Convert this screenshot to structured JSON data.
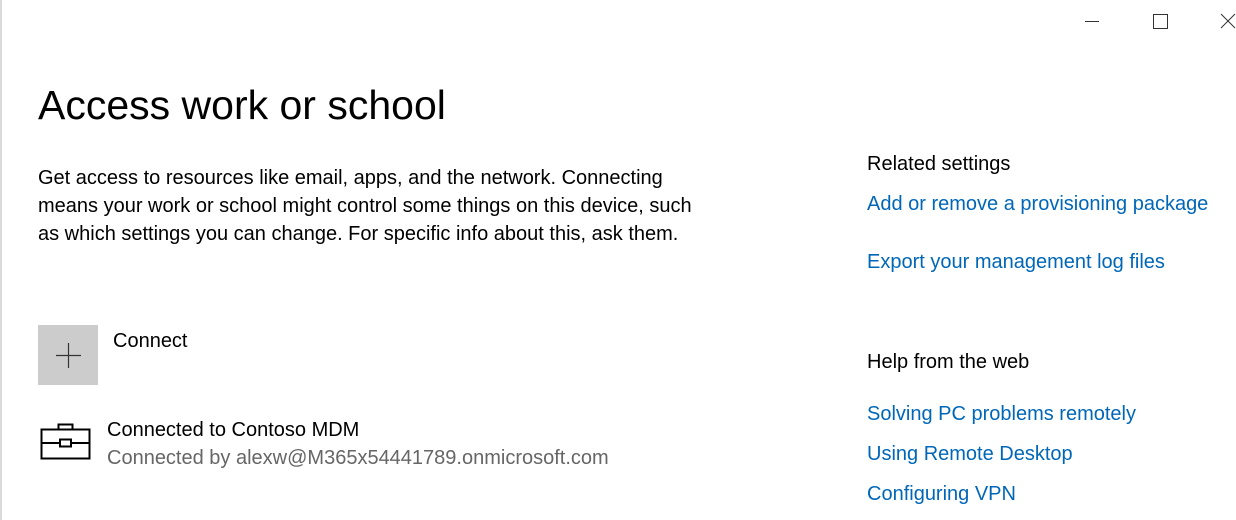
{
  "window": {
    "minimize_icon": "minimize-icon",
    "maximize_icon": "maximize-icon",
    "close_icon": "close-icon"
  },
  "main": {
    "title": "Access work or school",
    "description": "Get access to resources like email, apps, and the network. Connecting means your work or school might control some things on this device, such as which settings you can change. For specific info about this, ask them.",
    "connect": {
      "icon": "plus-icon",
      "label": "Connect"
    },
    "account": {
      "icon": "briefcase-icon",
      "title": "Connected to Contoso MDM",
      "subtitle": "Connected by alexw@M365x54441789.onmicrosoft.com"
    }
  },
  "related_settings": {
    "heading": "Related settings",
    "links": [
      "Add or remove a provisioning package",
      "Export your management log files"
    ]
  },
  "help_from_web": {
    "heading": "Help from the web",
    "links": [
      "Solving PC problems remotely",
      "Using Remote Desktop",
      "Configuring VPN"
    ]
  },
  "colors": {
    "link": "#0067b8",
    "connect_tile": "#cccccc",
    "secondary_text": "#666666"
  }
}
